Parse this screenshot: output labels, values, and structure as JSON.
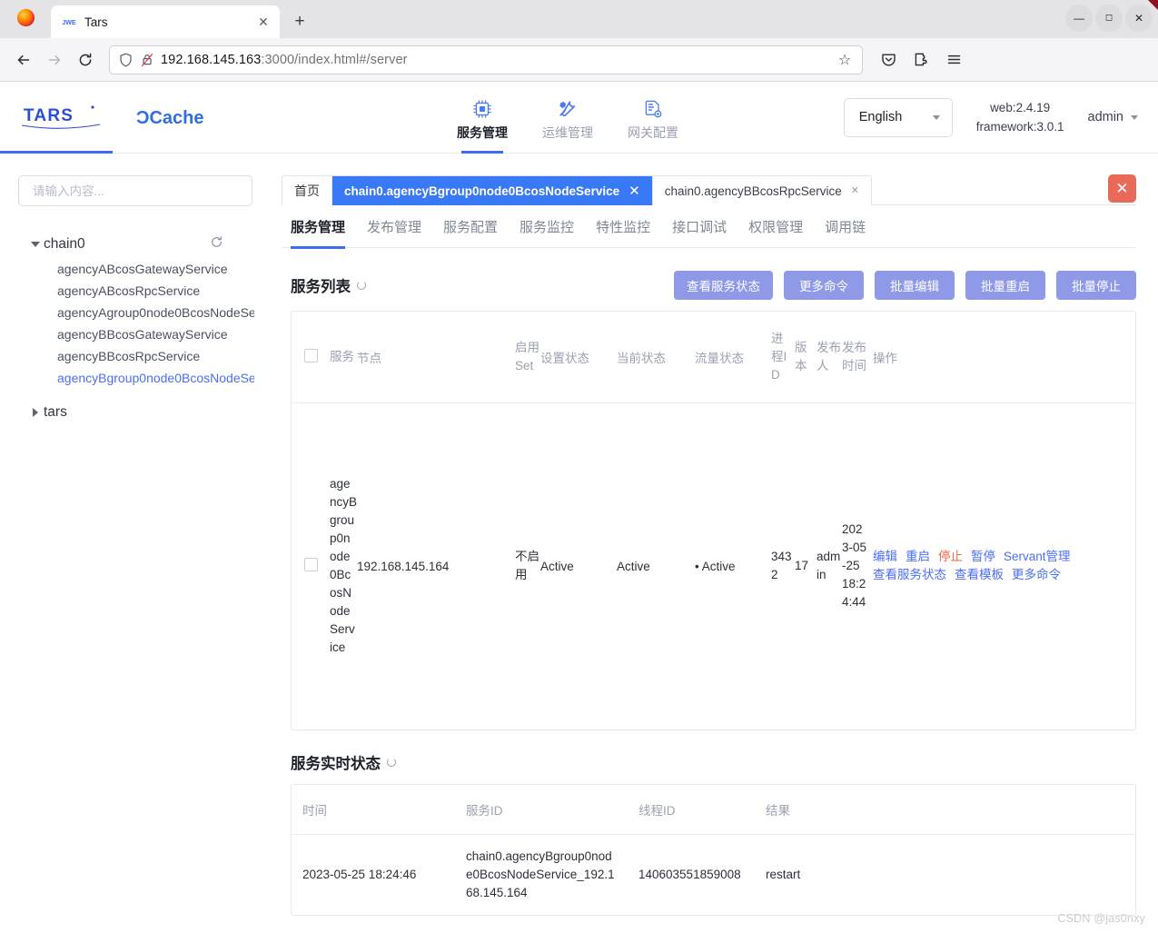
{
  "browser": {
    "tab_title": "Tars",
    "tab_close": "✕",
    "newtab": "+",
    "win_minimize": "—",
    "win_maximize": "◻",
    "win_close": "✕",
    "back": "←",
    "forward": "→",
    "reload": "⟳",
    "url_host": "192.168.145.163",
    "url_rest": ":3000/index.html#/server",
    "url_full": "192.168.145.163:3000/index.html#/server",
    "bookmark_star": "☆"
  },
  "header": {
    "brand_tars": "TARS",
    "brand_dcache": "DCache",
    "nav": [
      {
        "label": "服务管理",
        "icon": "chip-icon",
        "active": true
      },
      {
        "label": "运维管理",
        "icon": "tools-icon",
        "active": false
      },
      {
        "label": "网关配置",
        "icon": "gateway-config-icon",
        "active": false
      }
    ],
    "language": "English",
    "version_web": "web:2.4.19",
    "version_framework": "framework:3.0.1",
    "user": "admin"
  },
  "sidebar": {
    "search_placeholder": "请输入内容...",
    "search_value": "",
    "tree": [
      {
        "label": "chain0",
        "expanded": true,
        "children": [
          "agencyABcosGatewayService",
          "agencyABcosRpcService",
          "agencyAgroup0node0BcosNodeSe...",
          "agencyBBcosGatewayService",
          "agencyBBcosRpcService",
          "agencyBgroup0node0BcosNodeSe..."
        ],
        "selected_child_index": 5
      },
      {
        "label": "tars",
        "expanded": false,
        "children": []
      }
    ]
  },
  "page_tabs": {
    "items": [
      {
        "label": "首页",
        "active": false,
        "closable": false
      },
      {
        "label": "chain0.agencyBgroup0node0BcosNodeService",
        "active": true,
        "closable": true
      },
      {
        "label": "chain0.agencyBBcosRpcService",
        "active": false,
        "closable": true
      }
    ],
    "close_all": "✕"
  },
  "subtabs": [
    {
      "label": "服务管理",
      "active": true
    },
    {
      "label": "发布管理",
      "active": false
    },
    {
      "label": "服务配置",
      "active": false
    },
    {
      "label": "服务监控",
      "active": false
    },
    {
      "label": "特性监控",
      "active": false
    },
    {
      "label": "接口调试",
      "active": false
    },
    {
      "label": "权限管理",
      "active": false
    },
    {
      "label": "调用链",
      "active": false
    }
  ],
  "service_list": {
    "title": "服务列表",
    "buttons": [
      "查看服务状态",
      "更多命令",
      "批量编辑",
      "批量重启",
      "批量停止"
    ],
    "columns": [
      "",
      "服务",
      "节点",
      "启用Set",
      "设置状态",
      "当前状态",
      "流量状态",
      "进程ID",
      "版本",
      "发布人",
      "发布时间",
      "操作"
    ],
    "rows": [
      {
        "service": "agencyBgroup0node0BcosNodeService",
        "node": "192.168.145.164",
        "enable_set": "不启用",
        "set_status": "Active",
        "current_status": "Active",
        "flow_status": "Active",
        "process_id": "3432",
        "version": "17",
        "publisher": "admin",
        "publish_time": "2023-05-25 18:24:44",
        "ops": [
          {
            "label": "编辑",
            "kind": "link"
          },
          {
            "label": "重启",
            "kind": "link"
          },
          {
            "label": "停止",
            "kind": "danger"
          },
          {
            "label": "暂停",
            "kind": "link"
          },
          {
            "label": "Servant管理",
            "kind": "link"
          },
          {
            "label": "查看服务状态",
            "kind": "link"
          },
          {
            "label": "查看模板",
            "kind": "link"
          },
          {
            "label": "更多命令",
            "kind": "link"
          }
        ]
      }
    ]
  },
  "realtime": {
    "title": "服务实时状态",
    "columns": [
      "时间",
      "服务ID",
      "线程ID",
      "结果"
    ],
    "rows": [
      {
        "time": "2023-05-25 18:24:46",
        "service_id": "chain0.agencyBgroup0node0BcosNodeService_192.168.145.164",
        "thread_id": "140603551859008",
        "result": "restart"
      }
    ]
  },
  "watermark": "CSDN @jas0nxy",
  "colors": {
    "accent_blue": "#3a6df0",
    "tab_active": "#3a79f5",
    "button": "#8e99e8",
    "danger": "#ea6a5a",
    "link": "#4b6ef5",
    "green": "#4fbf7f",
    "stop_red": "#f06548"
  }
}
